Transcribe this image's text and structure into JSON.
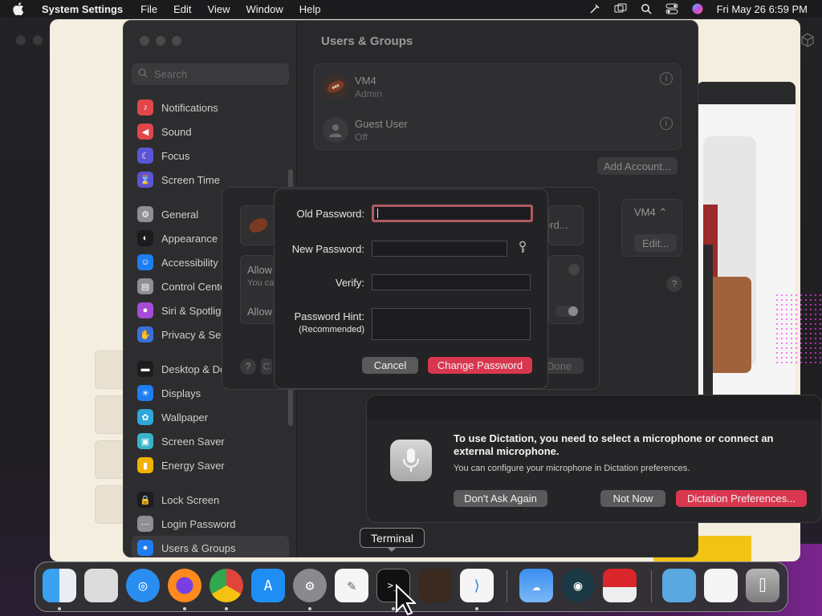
{
  "menubar": {
    "app_name": "System Settings",
    "menus": [
      "File",
      "Edit",
      "View",
      "Window",
      "Help"
    ],
    "datetime": "Fri May 26  6:59 PM"
  },
  "settings": {
    "search_placeholder": "Search",
    "title": "Users & Groups",
    "sidebar": {
      "group1": [
        {
          "label": "Notifications",
          "icon": "bell-icon",
          "color": "#e0464a"
        },
        {
          "label": "Sound",
          "icon": "speaker-icon",
          "color": "#e0464a"
        },
        {
          "label": "Focus",
          "icon": "moon-icon",
          "color": "#5b55d6"
        },
        {
          "label": "Screen Time",
          "icon": "hourglass-icon",
          "color": "#5b55d6"
        }
      ],
      "group2": [
        {
          "label": "General",
          "icon": "gear-icon",
          "color": "#8e8e93"
        },
        {
          "label": "Appearance",
          "icon": "appearance-icon",
          "color": "#1c1c1e"
        },
        {
          "label": "Accessibility",
          "icon": "accessibility-icon",
          "color": "#1e7ef0"
        },
        {
          "label": "Control Cente",
          "icon": "control-center-icon",
          "color": "#8e8e93"
        },
        {
          "label": "Siri & Spotlig",
          "icon": "siri-icon",
          "color": "#a64cd6"
        },
        {
          "label": "Privacy & Sec",
          "icon": "hand-icon",
          "color": "#3a6fd8"
        }
      ],
      "group3": [
        {
          "label": "Desktop & Do",
          "icon": "dock-icon",
          "color": "#1c1c1e"
        },
        {
          "label": "Displays",
          "icon": "sun-icon",
          "color": "#1e7ef0"
        },
        {
          "label": "Wallpaper",
          "icon": "wallpaper-icon",
          "color": "#2fa8d8"
        },
        {
          "label": "Screen Saver",
          "icon": "screensaver-icon",
          "color": "#36b5c8"
        },
        {
          "label": "Energy Saver",
          "icon": "battery-icon",
          "color": "#f2b300"
        }
      ],
      "group4": [
        {
          "label": "Lock Screen",
          "icon": "lock-icon",
          "color": "#1c1c1e"
        },
        {
          "label": "Login Password",
          "icon": "key-icon",
          "color": "#8e8e93"
        },
        {
          "label": "Users & Groups",
          "icon": "users-icon",
          "color": "#1e7ef0"
        }
      ]
    },
    "users": [
      {
        "name": "VM4",
        "role": "Admin"
      },
      {
        "name": "Guest User",
        "role": "Off"
      }
    ],
    "add_account_label": "Add Account...",
    "autologin_value": "VM4",
    "edit_label": "Edit...",
    "help": "?"
  },
  "back_dialog": {
    "allow1": "Allow",
    "allow1_sub": "You ca",
    "allow2": "Allow",
    "right_button": "ord...",
    "done_label": "Done",
    "help": "?",
    "help_side": "C"
  },
  "password_sheet": {
    "old_label": "Old Password:",
    "new_label": "New Password:",
    "verify_label": "Verify:",
    "hint_label": "Password Hint:",
    "hint_sub": "(Recommended)",
    "old_value": "",
    "new_value": "",
    "verify_value": "",
    "hint_value": "",
    "cancel_label": "Cancel",
    "change_label": "Change Password"
  },
  "dictation": {
    "title": "To use Dictation, you need to select a microphone or connect an external microphone.",
    "body": "You can configure your microphone in Dictation preferences.",
    "dont_ask": "Don't Ask Again",
    "not_now": "Not Now",
    "preferences": "Dictation Preferences..."
  },
  "tooltip": "Terminal",
  "dock": [
    {
      "name": "finder-icon",
      "running": true
    },
    {
      "name": "launchpad-icon",
      "running": false
    },
    {
      "name": "safari-icon",
      "running": false
    },
    {
      "name": "firefox-icon",
      "running": true
    },
    {
      "name": "chrome-icon",
      "running": true
    },
    {
      "name": "app-store-icon",
      "running": false
    },
    {
      "name": "system-settings-icon",
      "running": true
    },
    {
      "name": "textedit-icon",
      "running": false
    },
    {
      "name": "terminal-icon",
      "running": true
    },
    {
      "name": "garageband-icon",
      "running": false
    },
    {
      "name": "vscode-icon",
      "running": true
    },
    {
      "name": "weather-icon",
      "running": false
    },
    {
      "name": "app-icon",
      "running": false
    },
    {
      "name": "input-method-icon",
      "running": false
    },
    {
      "name": "downloads-folder-icon",
      "running": false
    },
    {
      "name": "document-stack-icon",
      "running": false
    },
    {
      "name": "trash-icon",
      "running": false
    }
  ]
}
